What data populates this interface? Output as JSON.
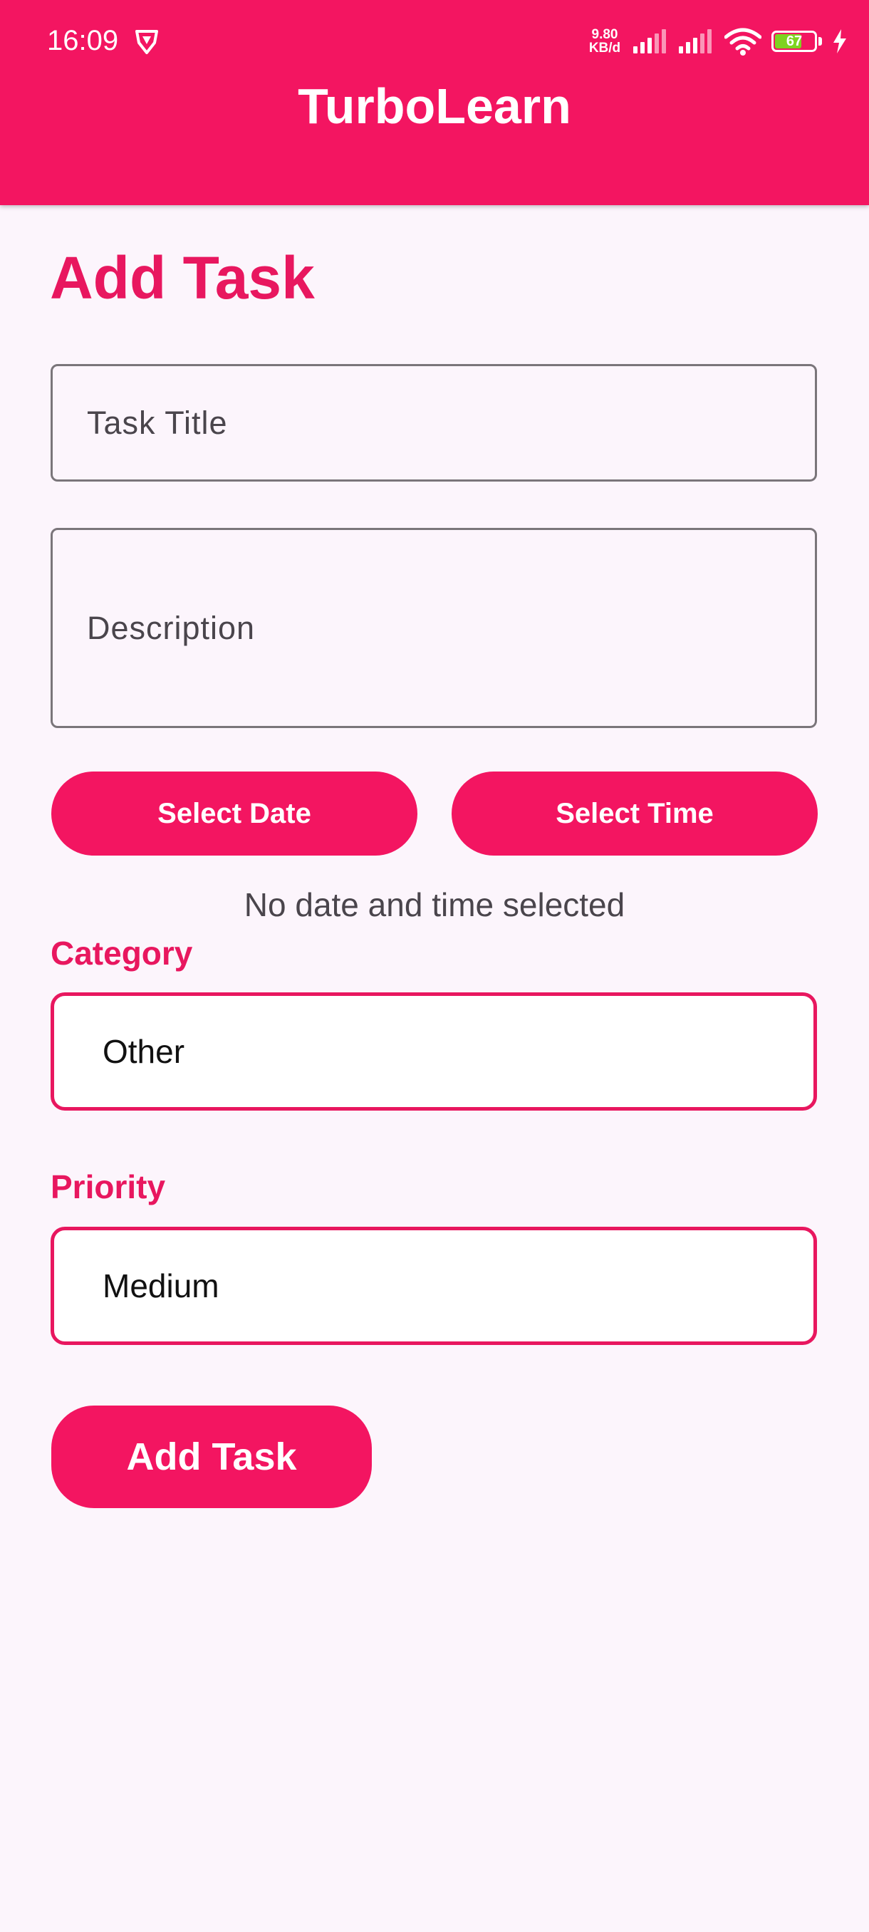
{
  "status_bar": {
    "time": "16:09",
    "net_speed_value": "9.80",
    "net_speed_unit": "KB/d",
    "battery_level": "67"
  },
  "app_bar": {
    "title": "TurboLearn"
  },
  "page": {
    "heading": "Add Task"
  },
  "form": {
    "title_placeholder": "Task Title",
    "description_placeholder": "Description",
    "select_date_label": "Select Date",
    "select_time_label": "Select Time",
    "date_time_status": "No date and time selected",
    "category_label": "Category",
    "category_value": "Other",
    "priority_label": "Priority",
    "priority_value": "Medium",
    "submit_label": "Add Task"
  },
  "colors": {
    "primary": "#F31561",
    "accent_text": "#E8175F",
    "background": "#FCF5FC"
  }
}
